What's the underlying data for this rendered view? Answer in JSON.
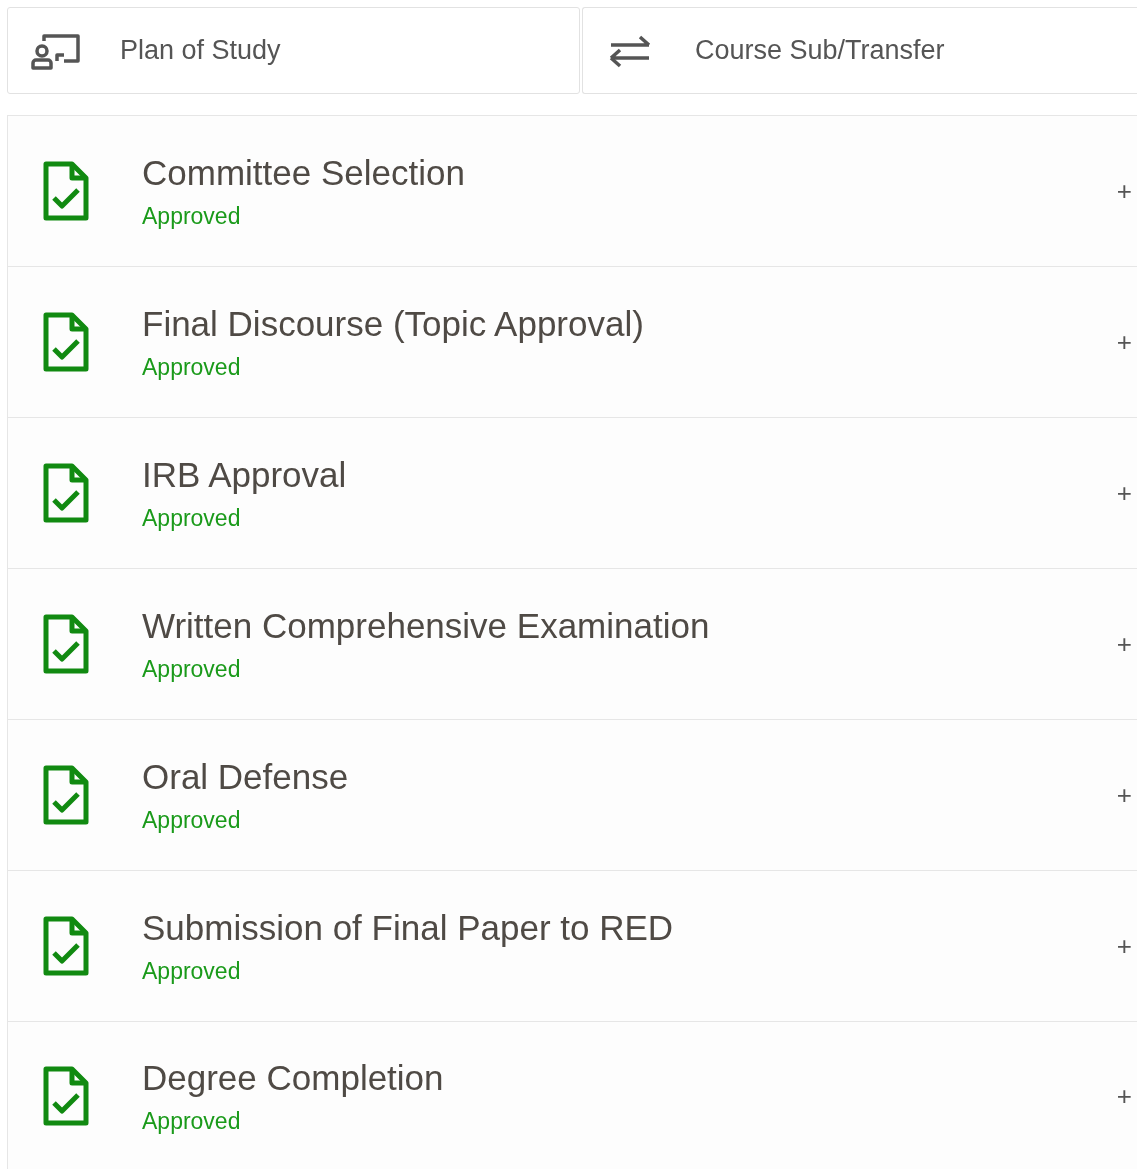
{
  "tabs": [
    {
      "label": "Plan of Study"
    },
    {
      "label": "Course Sub/Transfer"
    }
  ],
  "steps": [
    {
      "title": "Committee Selection",
      "status": "Approved",
      "kind": "approved",
      "toggle": "+"
    },
    {
      "title": "Final Discourse (Topic Approval)",
      "status": "Approved",
      "kind": "approved",
      "toggle": "+"
    },
    {
      "title": "IRB Approval",
      "status": "Approved",
      "kind": "approved",
      "toggle": "+"
    },
    {
      "title": "Written Comprehensive Examination",
      "status": "Approved",
      "kind": "approved",
      "toggle": "+"
    },
    {
      "title": "Oral Defense",
      "status": "Approved",
      "kind": "approved",
      "toggle": "+"
    },
    {
      "title": "Submission of Final Paper to RED",
      "status": "Approved",
      "kind": "approved",
      "toggle": "+"
    },
    {
      "title": "Degree Completion",
      "status": "Approved",
      "kind": "approved",
      "toggle": "+"
    }
  ]
}
